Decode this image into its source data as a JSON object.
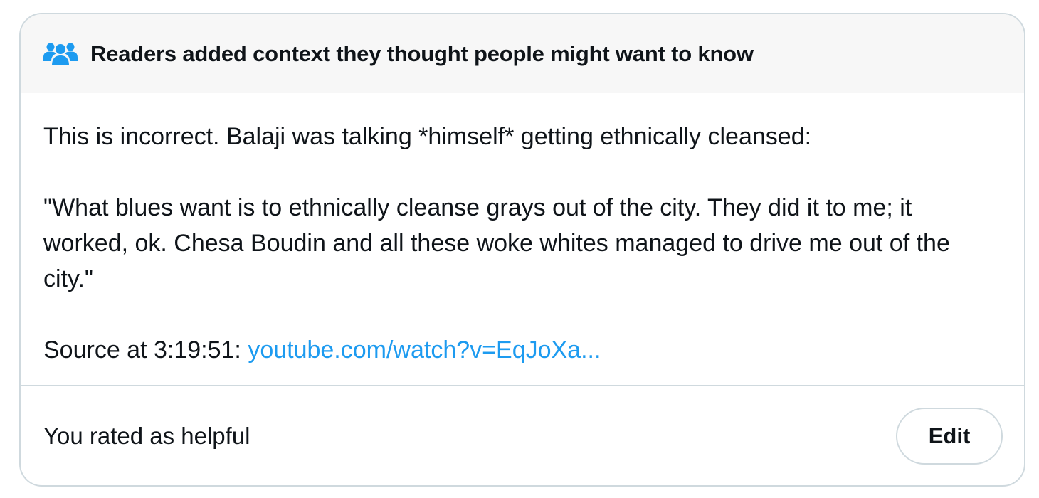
{
  "header": {
    "icon": "people-group-icon",
    "icon_color": "#1d9bf0",
    "title": "Readers added context they thought people might want to know"
  },
  "note": {
    "intro": "This is incorrect. Balaji was talking *himself* getting ethnically cleansed:",
    "quote": "\"What blues want is to ethnically cleanse grays out of the city. They did it to me; it worked, ok. Chesa Boudin and all these woke whites managed to drive me out of the city.\"",
    "source_prefix": "Source at 3:19:51: ",
    "source_link": "youtube.com/watch?v=EqJoXa..."
  },
  "footer": {
    "rating_status": "You rated as helpful",
    "edit_label": "Edit"
  },
  "colors": {
    "link": "#1d9bf0",
    "text": "#0f1419",
    "border": "#cfd9de",
    "header_bg": "#f7f7f7"
  }
}
